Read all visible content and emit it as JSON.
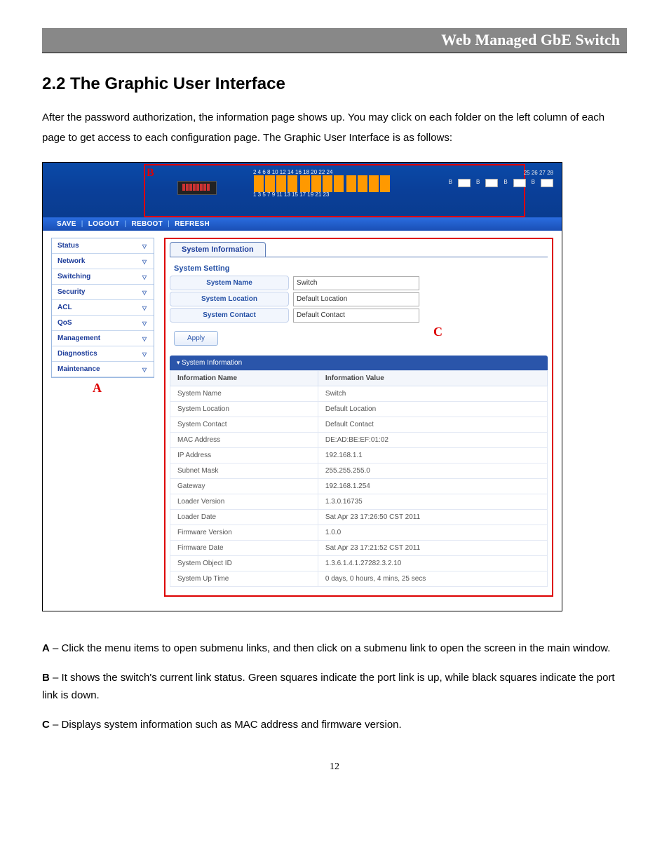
{
  "doc_header": "Web Managed GbE Switch",
  "section_title": "2.2 The Graphic User Interface",
  "intro_paragraph": "After the password authorization, the information page shows up. You may click on each folder on the left column of each page to get access to each configuration page. The Graphic User Interface is as follows:",
  "port_labels_top": "2   4   6   8   10 12 14 16   18 20 22 24",
  "port_labels_bottom": "1   3   5   7    9  11 13 15  17 19 21 23",
  "sfp_labels": "25     26     27     28",
  "toolbar": {
    "save": "SAVE",
    "logout": "LOGOUT",
    "reboot": "REBOOT",
    "refresh": "REFRESH"
  },
  "sidebar": {
    "items": [
      "Status",
      "Network",
      "Switching",
      "Security",
      "ACL",
      "QoS",
      "Management",
      "Diagnostics",
      "Maintenance"
    ]
  },
  "callout_a": "A",
  "callout_b": "B",
  "callout_c": "C",
  "tab_label": "System Information",
  "system_setting_heading": "System Setting",
  "settings": {
    "name_label": "System Name",
    "name_value": "Switch",
    "location_label": "System Location",
    "location_value": "Default Location",
    "contact_label": "System Contact",
    "contact_value": "Default Contact"
  },
  "apply_label": "Apply",
  "panel_title": "System Information",
  "table": {
    "head_name": "Information Name",
    "head_value": "Information Value",
    "rows": [
      {
        "n": "System Name",
        "v": "Switch"
      },
      {
        "n": "System Location",
        "v": "Default Location"
      },
      {
        "n": "System Contact",
        "v": "Default Contact"
      },
      {
        "n": "MAC Address",
        "v": "DE:AD:BE:EF:01:02"
      },
      {
        "n": "IP Address",
        "v": "192.168.1.1"
      },
      {
        "n": "Subnet Mask",
        "v": "255.255.255.0"
      },
      {
        "n": "Gateway",
        "v": "192.168.1.254"
      },
      {
        "n": "Loader Version",
        "v": "1.3.0.16735"
      },
      {
        "n": "Loader Date",
        "v": "Sat Apr 23 17:26:50 CST 2011"
      },
      {
        "n": "Firmware Version",
        "v": "1.0.0"
      },
      {
        "n": "Firmware Date",
        "v": "Sat Apr 23 17:21:52 CST 2011"
      },
      {
        "n": "System Object ID",
        "v": "1.3.6.1.4.1.27282.3.2.10"
      },
      {
        "n": "System Up Time",
        "v": "0 days, 0 hours, 4 mins, 25 secs"
      }
    ]
  },
  "legend": {
    "a_bold": "A",
    "a_text": " – Click the menu items to open submenu links, and then click on a submenu link to open the screen in the main window.",
    "b_bold": "B",
    "b_text": " – It shows the switch's current link status. Green squares indicate the port link is up, while black squares indicate the port link is down.",
    "c_bold": "C",
    "c_text": " – Displays system information such as MAC address and firmware version."
  },
  "page_number": "12"
}
